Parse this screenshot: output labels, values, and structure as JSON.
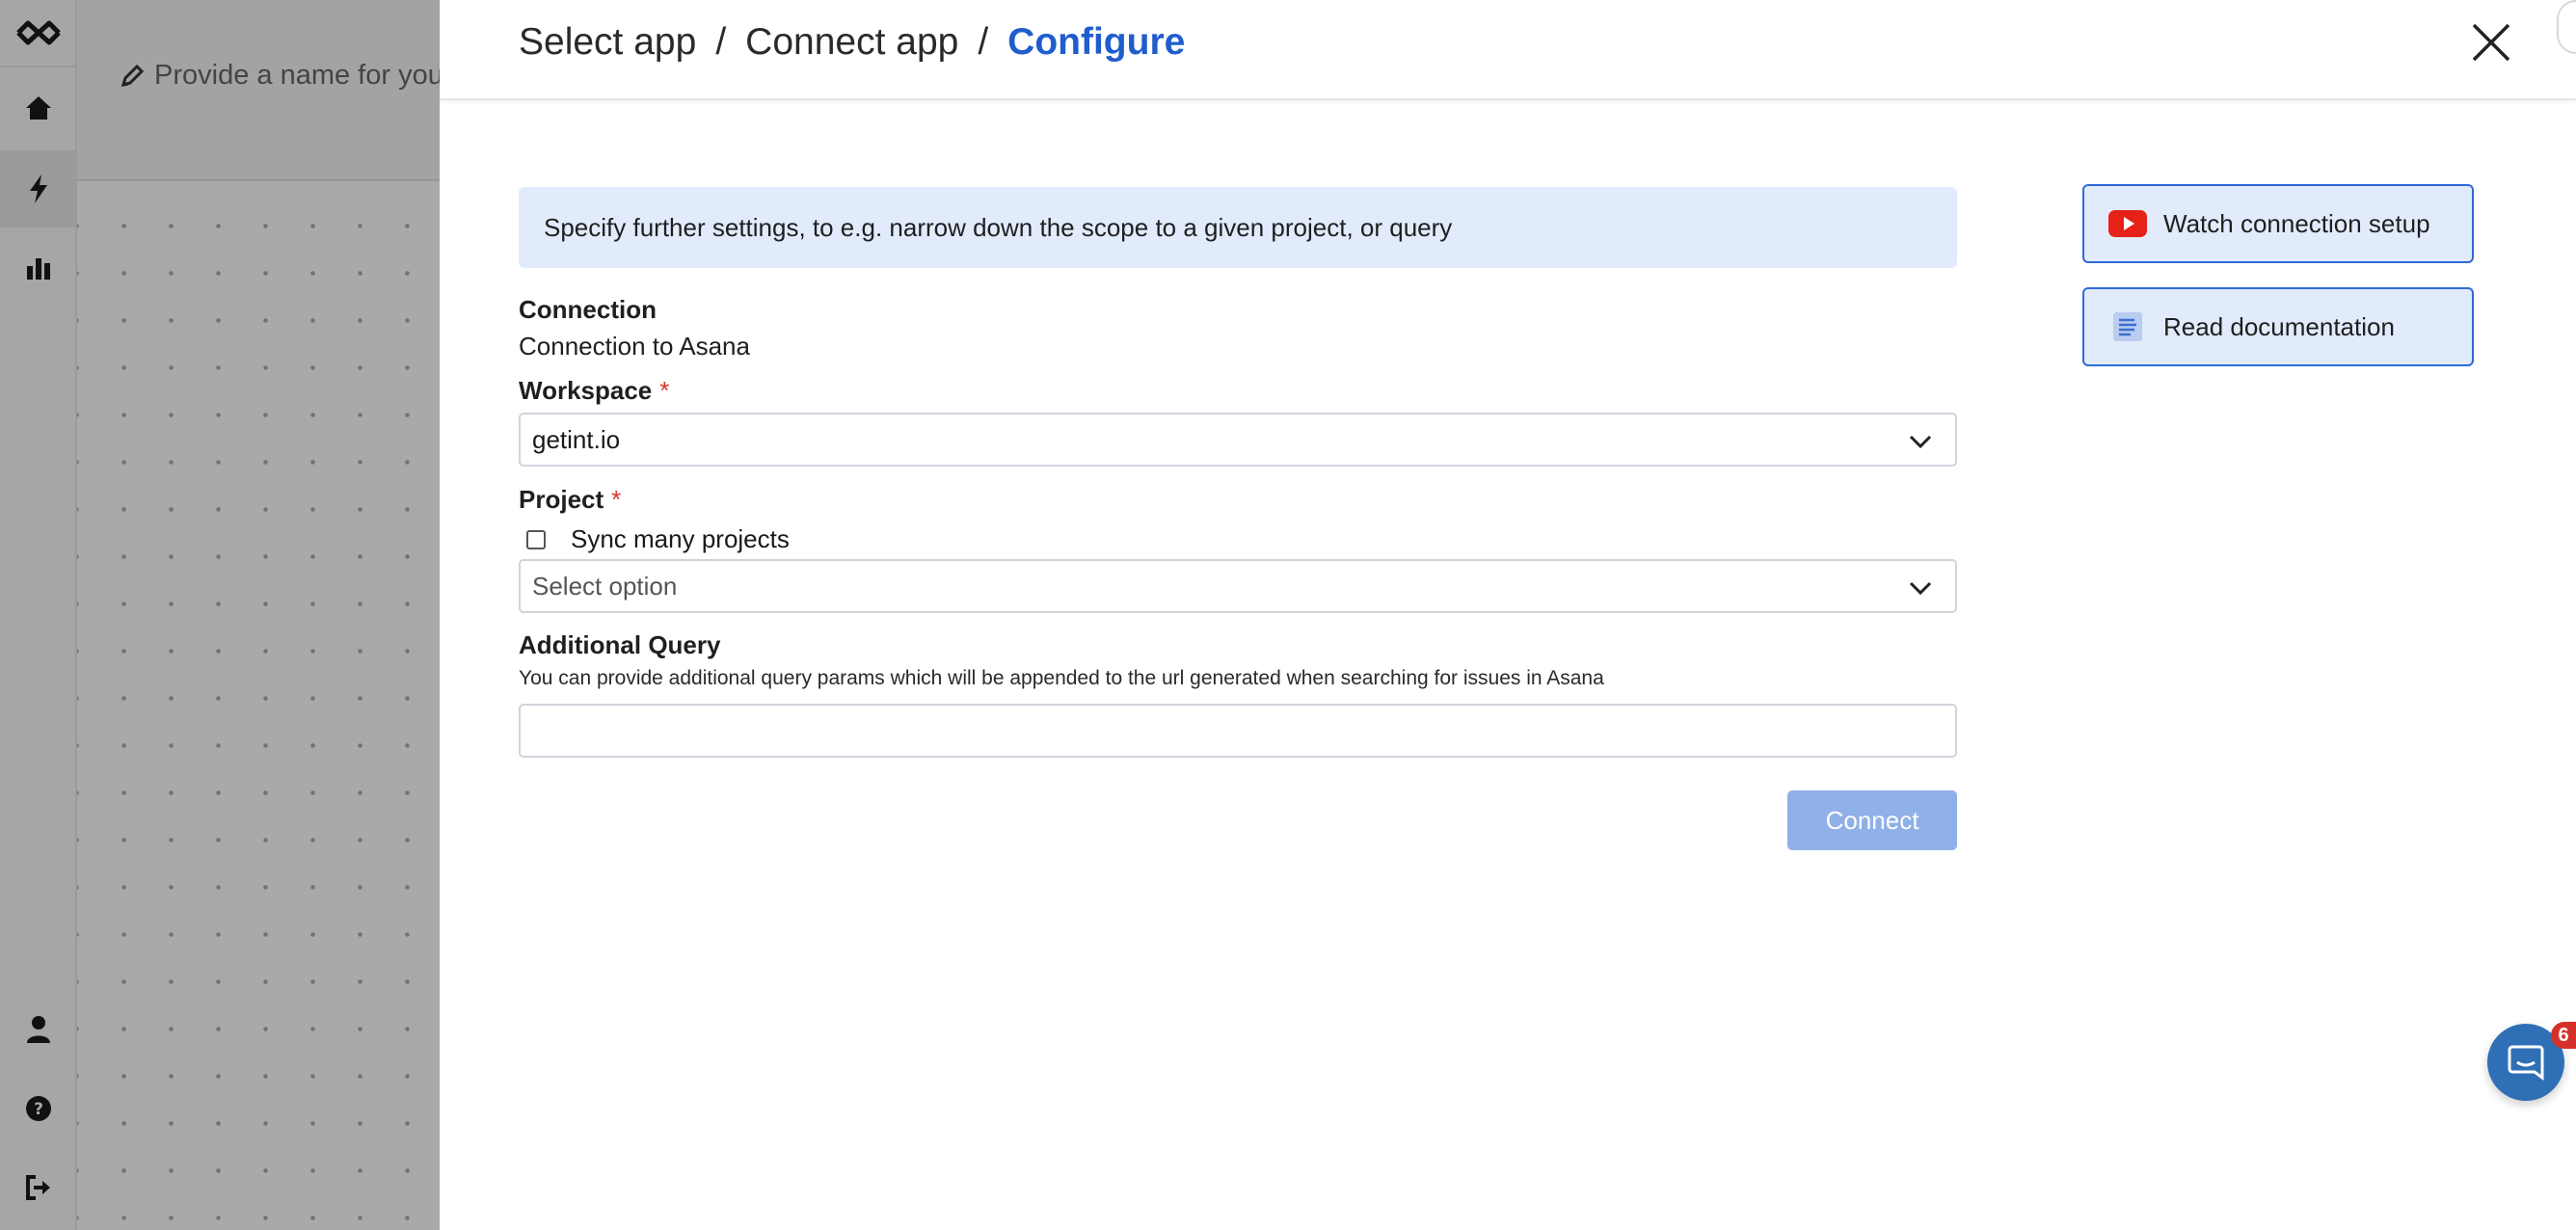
{
  "background": {
    "name_placeholder": "Provide a name for your"
  },
  "rail": {
    "icons": [
      "logo-icon",
      "home-icon",
      "bolt-icon",
      "bar-chart-icon",
      "user-icon",
      "help-icon",
      "logout-icon"
    ],
    "active_color": "#9a9a9a"
  },
  "modal": {
    "breadcrumb": {
      "step1": "Select app",
      "step2": "Connect app",
      "step3": "Configure",
      "separator": "/"
    },
    "info_text": "Specify further settings, to e.g. narrow down the scope to a given project, or query",
    "connection": {
      "label": "Connection",
      "value": "Connection to Asana"
    },
    "workspace": {
      "label": "Workspace",
      "required_mark": "*",
      "value": "getint.io"
    },
    "project": {
      "label": "Project",
      "required_mark": "*",
      "sync_many_label": "Sync many projects",
      "sync_many_checked": false,
      "placeholder": "Select option"
    },
    "additional_query": {
      "label": "Additional Query",
      "help": "You can provide additional query params which will be appended to the url generated when searching for issues in Asana",
      "value": ""
    },
    "connect_label": "Connect",
    "side_buttons": {
      "watch": "Watch connection setup",
      "docs": "Read documentation"
    }
  },
  "chat": {
    "badge_count": "6"
  },
  "colors": {
    "accent": "#1f5dcc",
    "info_bg": "#e1ebfb",
    "connect_disabled": "#8fb0e8",
    "required": "#d9352c",
    "youtube_red": "#e62117",
    "chat_blue": "#2f6fb5"
  }
}
